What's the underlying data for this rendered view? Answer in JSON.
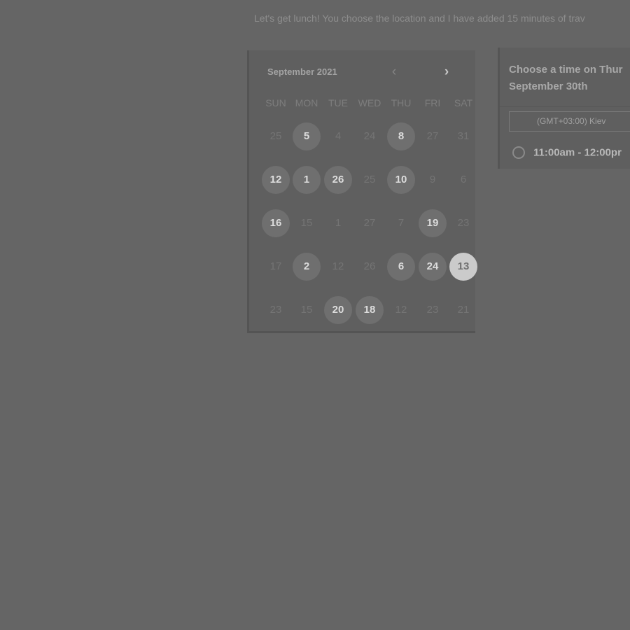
{
  "intro_text": "Let's get lunch! You choose the location and I have added 15 minutes of trav",
  "calendar": {
    "month_label": "September 2021",
    "prev_icon": "chevron-left-icon",
    "next_icon": "chevron-right-icon",
    "prev_glyph": "‹",
    "next_glyph": "›",
    "weekdays": [
      "SUN",
      "MON",
      "TUE",
      "WED",
      "THU",
      "FRI",
      "SAT"
    ],
    "weeks": [
      [
        {
          "label": "25",
          "state": "inactive"
        },
        {
          "label": "5",
          "state": "available"
        },
        {
          "label": "4",
          "state": "inactive"
        },
        {
          "label": "24",
          "state": "inactive"
        },
        {
          "label": "8",
          "state": "available"
        },
        {
          "label": "27",
          "state": "inactive"
        },
        {
          "label": "31",
          "state": "inactive"
        }
      ],
      [
        {
          "label": "12",
          "state": "available"
        },
        {
          "label": "1",
          "state": "available"
        },
        {
          "label": "26",
          "state": "available"
        },
        {
          "label": "25",
          "state": "inactive"
        },
        {
          "label": "10",
          "state": "available"
        },
        {
          "label": "9",
          "state": "inactive"
        },
        {
          "label": "6",
          "state": "inactive"
        }
      ],
      [
        {
          "label": "16",
          "state": "available"
        },
        {
          "label": "15",
          "state": "inactive"
        },
        {
          "label": "1",
          "state": "inactive"
        },
        {
          "label": "27",
          "state": "inactive"
        },
        {
          "label": "7",
          "state": "inactive"
        },
        {
          "label": "19",
          "state": "available"
        },
        {
          "label": "23",
          "state": "inactive"
        }
      ],
      [
        {
          "label": "17",
          "state": "inactive"
        },
        {
          "label": "2",
          "state": "available"
        },
        {
          "label": "12",
          "state": "inactive"
        },
        {
          "label": "26",
          "state": "inactive"
        },
        {
          "label": "6",
          "state": "available"
        },
        {
          "label": "24",
          "state": "available"
        },
        {
          "label": "13",
          "state": "selected"
        }
      ],
      [
        {
          "label": "23",
          "state": "inactive"
        },
        {
          "label": "15",
          "state": "inactive"
        },
        {
          "label": "20",
          "state": "available"
        },
        {
          "label": "18",
          "state": "available"
        },
        {
          "label": "12",
          "state": "inactive"
        },
        {
          "label": "23",
          "state": "inactive"
        },
        {
          "label": "21",
          "state": "inactive"
        }
      ]
    ]
  },
  "time_panel": {
    "heading_line1": "Choose a time on Thur",
    "heading_line2": "September 30th",
    "timezone_label": "(GMT+03:00) Kiev",
    "slots": [
      {
        "label": "11:00am - 12:00pr"
      }
    ]
  },
  "colors": {
    "background": "#656565",
    "panel": "#5f5f5f",
    "available_day": "#6f6f6f",
    "selected_day": "#cbcbcb"
  }
}
